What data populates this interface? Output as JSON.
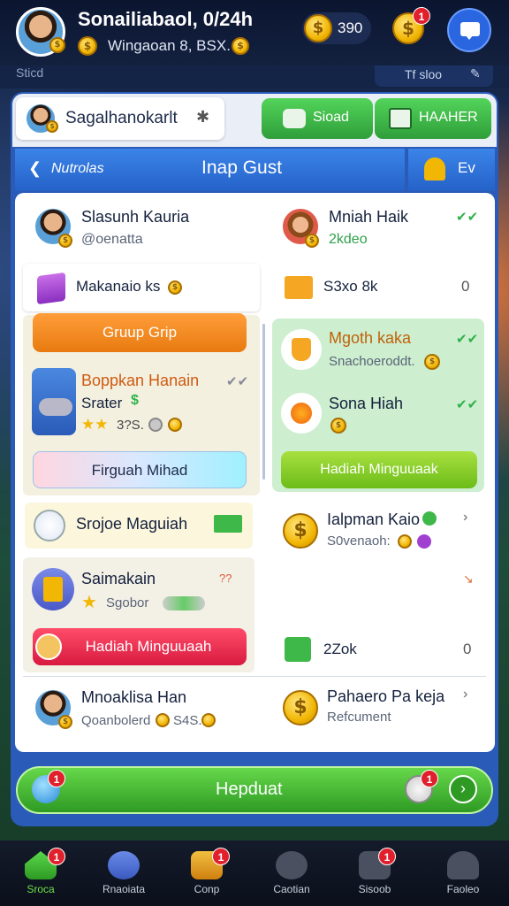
{
  "header": {
    "title": "Sonailiabaol, 0/24h",
    "subtitle": "Wingaoan 8, BSX.",
    "coins": "390",
    "notification_badge": "1"
  },
  "topstrip": {
    "left_label": "Sticd",
    "right_label": "Tf sloo"
  },
  "profile_chip": {
    "name": "Sagalhanokarlt"
  },
  "top_tabs": [
    {
      "label": "Sioad"
    },
    {
      "label": "HAAHER"
    }
  ],
  "panel_header": {
    "back_label": "Nutrolas",
    "title": "Inap Gust",
    "right_label": "Ev"
  },
  "players": [
    {
      "name": "Slasunh Kauria",
      "handle": "@oenatta"
    },
    {
      "name": "Mniah Haik",
      "handle": "2kdeo"
    }
  ],
  "row_items": [
    {
      "label": "Makanaio ks"
    },
    {
      "label": "S3xo 8k",
      "count": "0"
    }
  ],
  "group_button": "Gruup Grip",
  "game_card": {
    "title": "Boppkan Hanain",
    "sub": "Srater",
    "rating": "3?S.",
    "button": "Firguah Mihad"
  },
  "reward_items": [
    {
      "label": "Mgoth kaka",
      "sub": "Snachoeroddt."
    },
    {
      "label": "Sona Hiah"
    }
  ],
  "reward_button": "Hadiah Minguuaak",
  "promo": {
    "label": "Srojoe Maguiah",
    "item_label": "Ialpman Kaio",
    "item_sub": "S0venaoh:"
  },
  "second_card": {
    "title": "Saimakain",
    "sub": "Sgobor",
    "button": "Hadiah Minguuaah",
    "stat_label": "2Zok",
    "stat_count": "0",
    "marker": "??"
  },
  "bottom_player": {
    "name": "Mnoaklisa Han",
    "sub": "Qoanbolerd",
    "sub_val": "S4S."
  },
  "bottom_reward": {
    "label": "Pahaero Pa keja",
    "sub": "Refcument"
  },
  "cta": {
    "label": "Hepduat"
  },
  "nav": [
    {
      "label": "Sroca",
      "badge": "1"
    },
    {
      "label": "Rnaoiata",
      "badge": ""
    },
    {
      "label": "Conp",
      "badge": "1"
    },
    {
      "label": "Caotian",
      "badge": ""
    },
    {
      "label": "Sisoob",
      "badge": "1"
    },
    {
      "label": "Faoleo",
      "badge": ""
    }
  ],
  "colors": {
    "accent_blue": "#2a6fd6",
    "green": "#3fb84a",
    "orange": "#f08a24",
    "pink": "#e8385a",
    "gold": "#f2b705"
  }
}
